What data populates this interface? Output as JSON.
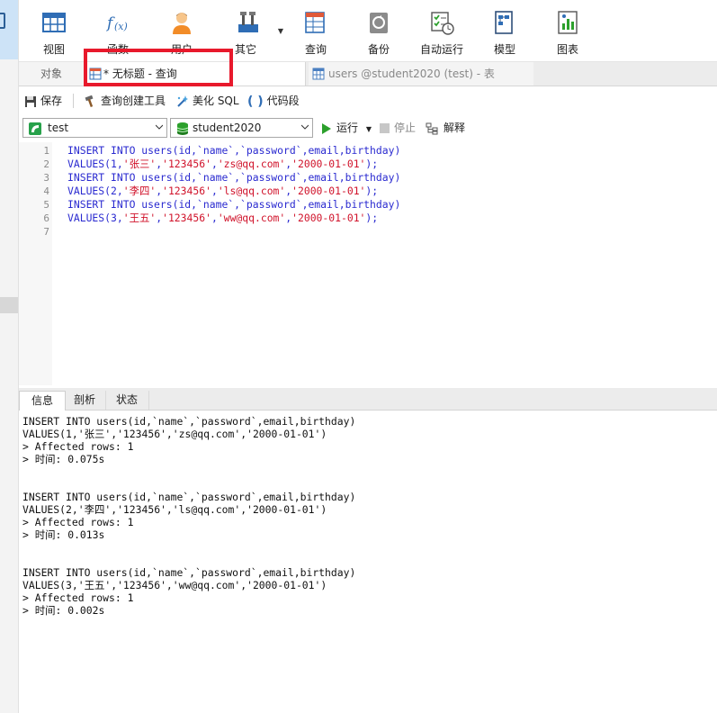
{
  "toolbar": {
    "items": [
      {
        "label": "视图",
        "icon": "view-icon"
      },
      {
        "label": "函数",
        "icon": "function-icon"
      },
      {
        "label": "用户",
        "icon": "user-icon"
      },
      {
        "label": "其它",
        "icon": "tools-icon"
      },
      {
        "label": "查询",
        "icon": "query-icon"
      },
      {
        "label": "备份",
        "icon": "backup-icon"
      },
      {
        "label": "自动运行",
        "icon": "auto-run-icon"
      },
      {
        "label": "模型",
        "icon": "model-icon"
      },
      {
        "label": "图表",
        "icon": "chart-icon"
      }
    ]
  },
  "tabs": {
    "objects": "对象",
    "query": "* 无标题 - 查询",
    "table": "users @student2020 (test) - 表"
  },
  "editor_toolbar": {
    "save": "保存",
    "query_builder": "查询创建工具",
    "beautify": "美化 SQL",
    "snippet": "代码段"
  },
  "selector": {
    "connection": "test",
    "database": "student2020",
    "run": "运行",
    "stop": "停止",
    "explain": "解释"
  },
  "editor": {
    "line_numbers": [
      "1",
      "2",
      "3",
      "4",
      "5",
      "6",
      "7"
    ],
    "lines": [
      {
        "parts": [
          {
            "t": "INSERT INTO users(id,`name`,`password`,email,birthday)",
            "s": false
          }
        ]
      },
      {
        "parts": [
          {
            "t": "VALUES(1,",
            "s": false
          },
          {
            "t": "'张三'",
            "s": true
          },
          {
            "t": ",",
            "s": false
          },
          {
            "t": "'123456'",
            "s": true
          },
          {
            "t": ",",
            "s": false
          },
          {
            "t": "'zs@qq.com'",
            "s": true
          },
          {
            "t": ",",
            "s": false
          },
          {
            "t": "'2000-01-01'",
            "s": true
          },
          {
            "t": ");",
            "s": false
          }
        ]
      },
      {
        "parts": [
          {
            "t": "INSERT INTO users(id,`name`,`password`,email,birthday)",
            "s": false
          }
        ]
      },
      {
        "parts": [
          {
            "t": "VALUES(2,",
            "s": false
          },
          {
            "t": "'李四'",
            "s": true
          },
          {
            "t": ",",
            "s": false
          },
          {
            "t": "'123456'",
            "s": true
          },
          {
            "t": ",",
            "s": false
          },
          {
            "t": "'ls@qq.com'",
            "s": true
          },
          {
            "t": ",",
            "s": false
          },
          {
            "t": "'2000-01-01'",
            "s": true
          },
          {
            "t": ");",
            "s": false
          }
        ]
      },
      {
        "parts": [
          {
            "t": "INSERT INTO users(id,`name`,`password`,email,birthday)",
            "s": false
          }
        ]
      },
      {
        "parts": [
          {
            "t": "VALUES(3,",
            "s": false
          },
          {
            "t": "'王五'",
            "s": true
          },
          {
            "t": ",",
            "s": false
          },
          {
            "t": "'123456'",
            "s": true
          },
          {
            "t": ",",
            "s": false
          },
          {
            "t": "'ww@qq.com'",
            "s": true
          },
          {
            "t": ",",
            "s": false
          },
          {
            "t": "'2000-01-01'",
            "s": true
          },
          {
            "t": ");",
            "s": false
          }
        ]
      },
      {
        "parts": []
      }
    ]
  },
  "result_tabs": {
    "info": "信息",
    "explain": "剖析",
    "status": "状态"
  },
  "results": {
    "blocks": [
      {
        "lines": [
          "INSERT INTO users(id,`name`,`password`,email,birthday)",
          "VALUES(1,'张三','123456','zs@qq.com','2000-01-01')",
          "> Affected rows: 1",
          "> 时间: 0.075s"
        ]
      },
      {
        "lines": [
          "INSERT INTO users(id,`name`,`password`,email,birthday)",
          "VALUES(2,'李四','123456','ls@qq.com','2000-01-01')",
          "> Affected rows: 1",
          "> 时间: 0.013s"
        ]
      },
      {
        "lines": [
          "INSERT INTO users(id,`name`,`password`,email,birthday)",
          "VALUES(3,'王五','123456','ww@qq.com','2000-01-01')",
          "> Affected rows: 1",
          "> 时间: 0.002s"
        ]
      }
    ]
  },
  "colors": {
    "keyword": "#2a2ad0",
    "string": "#d0122a",
    "highlight_box": "#e8192c",
    "run_green": "#2ca02c"
  }
}
